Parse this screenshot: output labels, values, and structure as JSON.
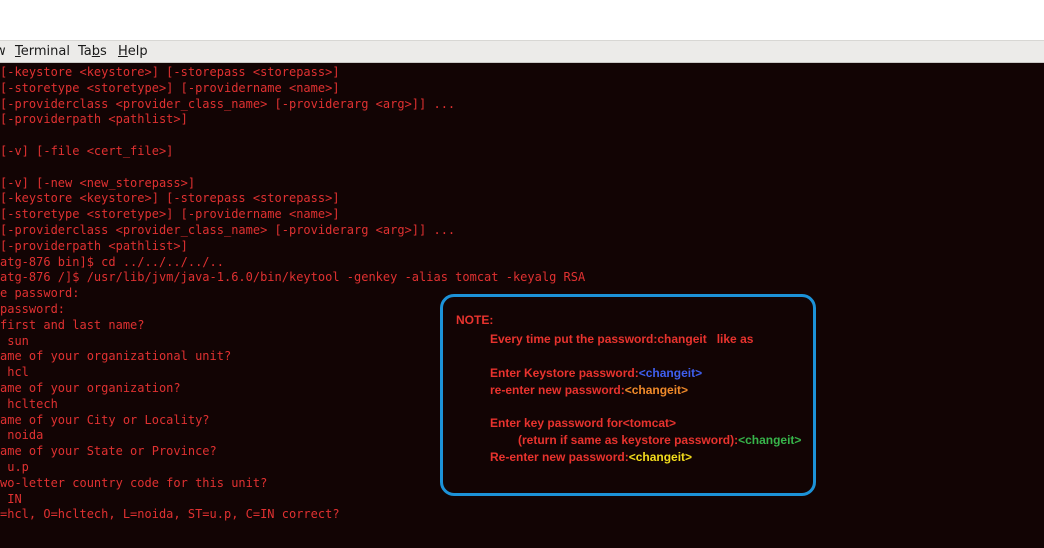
{
  "menu": {
    "partial_item": "w",
    "terminal_label": "Terminal",
    "tabs_label": "Tabs",
    "help_label": "Help"
  },
  "terminal": {
    "lines": [
      "[-keystore <keystore>] [-storepass <storepass>]",
      "[-storetype <storetype>] [-providername <name>]",
      "[-providerclass <provider_class_name> [-providerarg <arg>]] ...",
      "[-providerpath <pathlist>]",
      "",
      "[-v] [-file <cert_file>]",
      "",
      "[-v] [-new <new_storepass>]",
      "[-keystore <keystore>] [-storepass <storepass>]",
      "[-storetype <storetype>] [-providername <name>]",
      "[-providerclass <provider_class_name> [-providerarg <arg>]] ...",
      "[-providerpath <pathlist>]",
      "atg-876 bin]$ cd ../../../../..",
      "atg-876 /]$ /usr/lib/jvm/java-1.6.0/bin/keytool -genkey -alias tomcat -keyalg RSA",
      "e password:",
      "password:",
      "first and last name?",
      " sun",
      "ame of your organizational unit?",
      " hcl",
      "ame of your organization?",
      " hcltech",
      "ame of your City or Locality?",
      " noida",
      "ame of your State or Province?",
      " u.p",
      "wo-letter country code for this unit?",
      " IN",
      "=hcl, O=hcltech, L=noida, ST=u.p, C=IN correct?"
    ]
  },
  "note": {
    "title": "NOTE:",
    "line1": "Every time put the password:changeit   like as",
    "line2_label": "Enter Keystore password:",
    "line2_value": "<changeit>",
    "line3_label": "re-enter new password:",
    "line3_value": "<changeit>",
    "line4_label": "Enter key password for<tomcat>",
    "line5_label": "(return if same as keystore password):",
    "line5_value": "<changeit>",
    "line6_label": "Re-enter new password:",
    "line6_value": "<changeit>"
  },
  "colors": {
    "terminal_bg": "#120404",
    "terminal_text": "#e03131",
    "note_border": "#1c92d8",
    "note_title": "#1b9ee2",
    "note_text": "#e8332e"
  }
}
